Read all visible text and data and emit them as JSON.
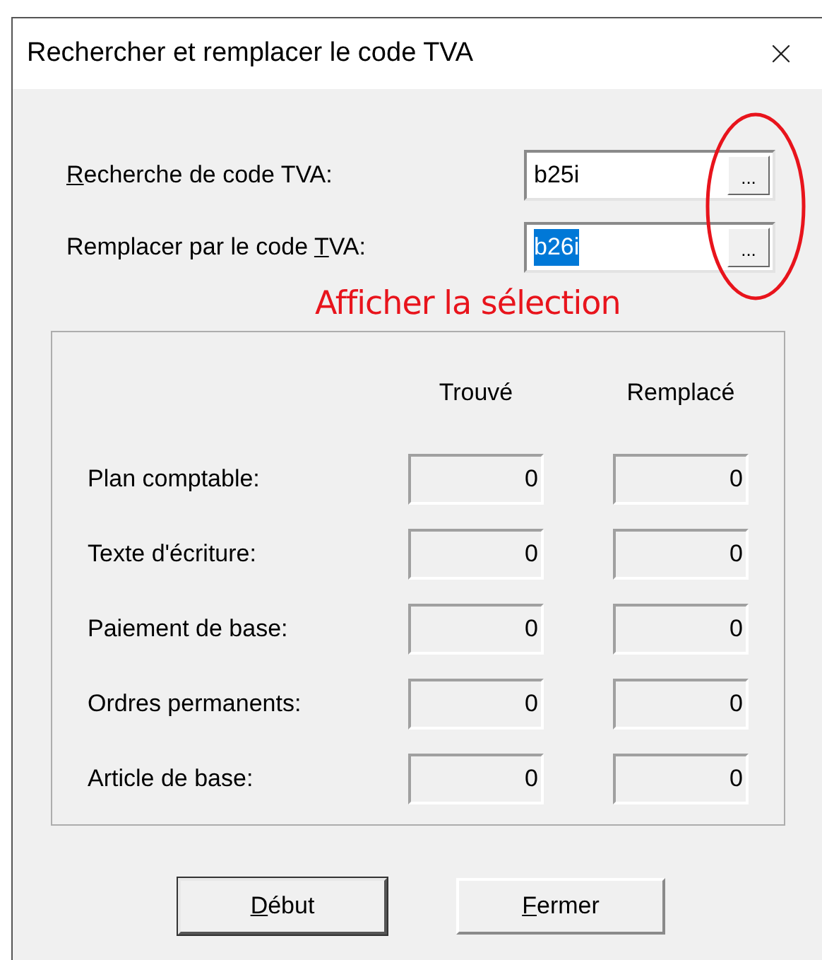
{
  "window": {
    "title": "Rechercher et remplacer le code TVA"
  },
  "fields": [
    {
      "access_key": "R",
      "label_after": "echerche de code TVA:",
      "value": "b25i",
      "text_selected": false,
      "button": "..."
    },
    {
      "label_before": "Remplacer par le code ",
      "access_key": "T",
      "label_after": "VA:",
      "value": "b26i",
      "text_selected": true,
      "button": "..."
    }
  ],
  "annotation": "Afficher la sélection",
  "results": {
    "columns": [
      "Trouvé",
      "Remplacé"
    ],
    "rows": [
      {
        "label": "Plan comptable:",
        "found": "0",
        "replaced": "0"
      },
      {
        "label": "Texte d'écriture:",
        "found": "0",
        "replaced": "0"
      },
      {
        "label": "Paiement de base:",
        "found": "0",
        "replaced": "0"
      },
      {
        "label": "Ordres permanents:",
        "found": "0",
        "replaced": "0"
      },
      {
        "label": "Article de base:",
        "found": "0",
        "replaced": "0"
      }
    ]
  },
  "buttons": [
    {
      "access_key": "D",
      "label_after": "ébut",
      "default": true
    },
    {
      "access_key": "F",
      "label_after": "ermer",
      "default": false
    }
  ]
}
